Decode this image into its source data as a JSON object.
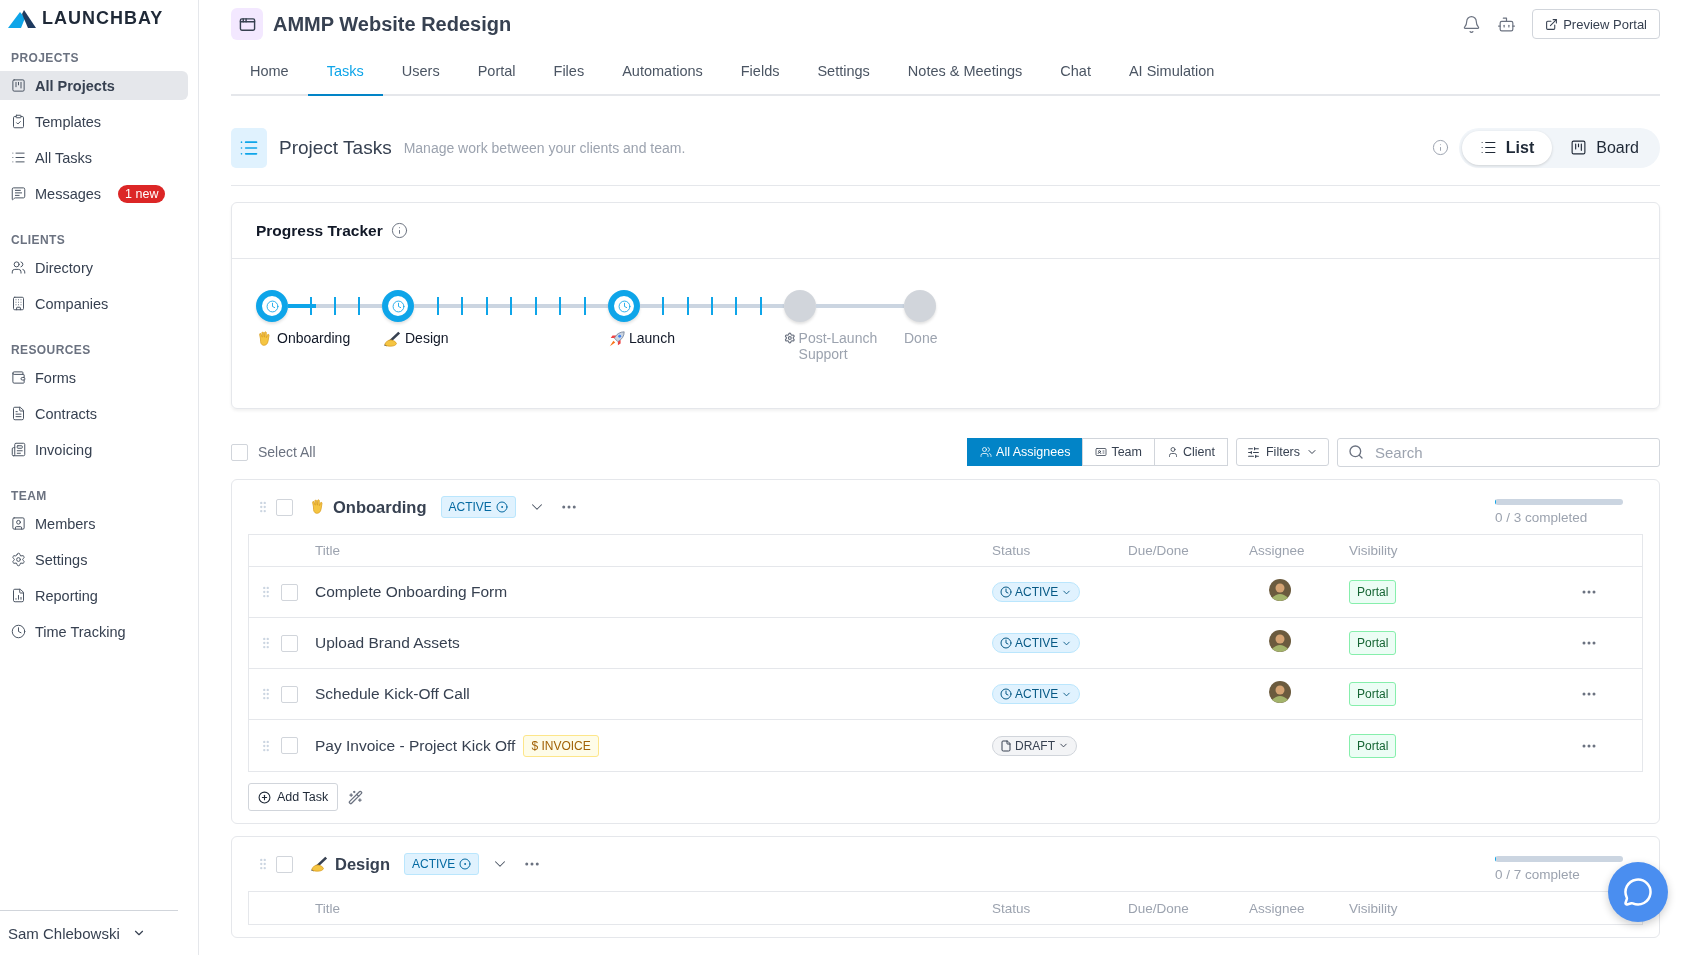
{
  "brand": {
    "name": "LAUNCHBAY"
  },
  "sidebar": {
    "sections": [
      {
        "title": "PROJECTS",
        "items": [
          {
            "label": "All Projects",
            "selected": true
          },
          {
            "label": "Templates",
            "selected": false
          },
          {
            "label": "All Tasks",
            "selected": false
          },
          {
            "label": "Messages",
            "selected": false,
            "badge": "1 new"
          }
        ]
      },
      {
        "title": "CLIENTS",
        "items": [
          {
            "label": "Directory",
            "selected": false
          },
          {
            "label": "Companies",
            "selected": false
          }
        ]
      },
      {
        "title": "RESOURCES",
        "items": [
          {
            "label": "Forms",
            "selected": false
          },
          {
            "label": "Contracts",
            "selected": false
          },
          {
            "label": "Invoicing",
            "selected": false
          }
        ]
      },
      {
        "title": "TEAM",
        "items": [
          {
            "label": "Members",
            "selected": false
          },
          {
            "label": "Settings",
            "selected": false
          },
          {
            "label": "Reporting",
            "selected": false
          },
          {
            "label": "Time Tracking",
            "selected": false
          }
        ]
      }
    ],
    "user": "Sam Chlebowski"
  },
  "header": {
    "title": "AMMP Website Redesign",
    "preview_button": "Preview Portal"
  },
  "tabs": [
    {
      "label": "Home",
      "selected": false
    },
    {
      "label": "Tasks",
      "selected": true
    },
    {
      "label": "Users",
      "selected": false
    },
    {
      "label": "Portal",
      "selected": false
    },
    {
      "label": "Files",
      "selected": false
    },
    {
      "label": "Automations",
      "selected": false
    },
    {
      "label": "Fields",
      "selected": false
    },
    {
      "label": "Settings",
      "selected": false
    },
    {
      "label": "Notes & Meetings",
      "selected": false
    },
    {
      "label": "Chat",
      "selected": false
    },
    {
      "label": "AI Simulation",
      "selected": false
    }
  ],
  "section": {
    "title": "Project Tasks",
    "subtitle": "Manage work between your clients and team.",
    "views": [
      {
        "label": "List",
        "selected": true
      },
      {
        "label": "Board",
        "selected": false
      }
    ]
  },
  "progress_tracker": {
    "title": "Progress Tracker",
    "steps": [
      {
        "label": "Onboarding",
        "reached": true,
        "connector": {
          "level": 0.3
        }
      },
      {
        "label": "Design",
        "reached": true
      },
      {
        "label": "Launch",
        "reached": true
      },
      {
        "label": "Post-Launch Support",
        "reached": false
      },
      {
        "label": "Done",
        "reached": false
      }
    ]
  },
  "toolbar": {
    "select_all": {
      "label": "Select All",
      "checked": false
    },
    "assignee_filters": [
      {
        "label": "All Assignees",
        "selected": true
      },
      {
        "label": "Team",
        "selected": false
      },
      {
        "label": "Client",
        "selected": false
      }
    ],
    "filters_button": "Filters",
    "search": {
      "placeholder": "Search"
    }
  },
  "groups": [
    {
      "title": "Onboarding",
      "checked": false,
      "status": "ACTIVE",
      "progress": {
        "level": 0,
        "label": "0 / 3 completed"
      },
      "columns": [
        "Title",
        "Status",
        "Due/Done",
        "Assignee",
        "Visibility"
      ],
      "tasks": [
        {
          "title": "Complete Onboarding Form",
          "checked": false,
          "status": {
            "label": "ACTIVE",
            "kind": "active"
          },
          "assigned": true,
          "visibility": "Portal"
        },
        {
          "title": "Upload Brand Assets",
          "checked": false,
          "status": {
            "label": "ACTIVE",
            "kind": "active"
          },
          "assigned": true,
          "visibility": "Portal"
        },
        {
          "title": "Schedule Kick-Off Call",
          "checked": false,
          "status": {
            "label": "ACTIVE",
            "kind": "active"
          },
          "assigned": true,
          "visibility": "Portal"
        },
        {
          "title": "Pay Invoice - Project Kick Off",
          "tag": "$ INVOICE",
          "checked": false,
          "status": {
            "label": "DRAFT",
            "kind": "draft"
          },
          "assigned": false,
          "visibility": "Portal"
        }
      ],
      "add_button": "Add Task"
    },
    {
      "title": "Design",
      "checked": false,
      "status": "ACTIVE",
      "progress": {
        "level": 0,
        "label": "0 / 7 complete"
      },
      "columns": [
        "Title",
        "Status",
        "Due/Done",
        "Assignee",
        "Visibility"
      ]
    }
  ]
}
